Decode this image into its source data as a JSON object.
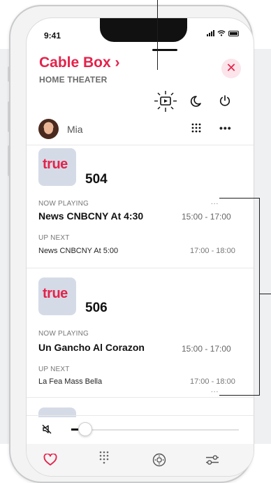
{
  "status_bar": {
    "time": "9:41"
  },
  "header": {
    "title": "Cable Box ›",
    "subtitle": "HOME THEATER"
  },
  "toolbar_icons": [
    "input-source-icon",
    "moon-icon",
    "power-icon"
  ],
  "user": {
    "name": "Mia",
    "avatar": "mia-avatar"
  },
  "channels": [
    {
      "logo_text": "true",
      "number": "504",
      "now_label": "NOW PLAYING",
      "now_title": "News CNBCNY At  4:30",
      "now_time": "15:00 - 17:00",
      "next_label": "UP NEXT",
      "next_title": "News CNBCNY At 5:00",
      "next_time": "17:00 - 18:00",
      "more": "..."
    },
    {
      "logo_text": "true",
      "number": "506",
      "now_label": "NOW PLAYING",
      "now_title": "Un Gancho Al Corazon",
      "now_time": "15:00 - 17:00",
      "next_label": "UP NEXT",
      "next_title": "La Fea Mass Bella",
      "next_time": "17:00 - 18:00",
      "more": "..."
    }
  ],
  "volume": {
    "level": 0.04,
    "muted": true
  },
  "tab_bar": [
    "heart-icon",
    "keypad-icon",
    "dpad-icon",
    "settings-icon"
  ],
  "colors": {
    "accent": "#e4234b",
    "channel_tile": "#d5dbe6",
    "outer_band": "#eff0f2"
  }
}
